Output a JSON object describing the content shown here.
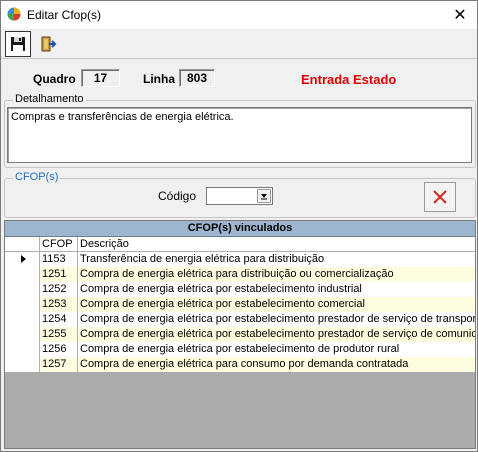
{
  "window": {
    "title": "Editar Cfop(s)",
    "close_glyph": "✕"
  },
  "toolbar": {
    "save_icon": "floppy-disk-icon",
    "exit_icon": "exit-door-icon"
  },
  "header": {
    "quadro_label": "Quadro",
    "quadro_value": "17",
    "linha_label": "Linha",
    "linha_value": "803",
    "status": "Entrada Estado",
    "status_color": "#e00000"
  },
  "detalhamento": {
    "label": "Detalhamento",
    "text": "Compras e transferências de energia elétrica."
  },
  "cfops_group": {
    "label": "CFOP(s)",
    "label_color": "#1f6fc0",
    "codigo_label": "Código",
    "codigo_value": "",
    "delete_icon": "red-x-delete-icon"
  },
  "grid": {
    "title": "CFOP(s) vinculados",
    "title_bg": "#9db5cf",
    "columns": [
      "CFOP",
      "Descrição"
    ],
    "rows": [
      {
        "cfop": "1153",
        "descricao": "Transferência de energia elétrica para distribuição",
        "current": true
      },
      {
        "cfop": "1251",
        "descricao": "Compra de energia elétrica para distribuição ou comercialização"
      },
      {
        "cfop": "1252",
        "descricao": "Compra de energia elétrica por estabelecimento industrial"
      },
      {
        "cfop": "1253",
        "descricao": "Compra de energia elétrica por estabelecimento comercial"
      },
      {
        "cfop": "1254",
        "descricao": "Compra de energia elétrica por estabelecimento prestador de serviço de transport"
      },
      {
        "cfop": "1255",
        "descricao": "Compra de energia elétrica por estabelecimento prestador de serviço de comunica"
      },
      {
        "cfop": "1256",
        "descricao": "Compra de energia elétrica por estabelecimento de produtor rural"
      },
      {
        "cfop": "1257",
        "descricao": "Compra de energia elétrica para consumo por demanda contratada"
      }
    ]
  }
}
